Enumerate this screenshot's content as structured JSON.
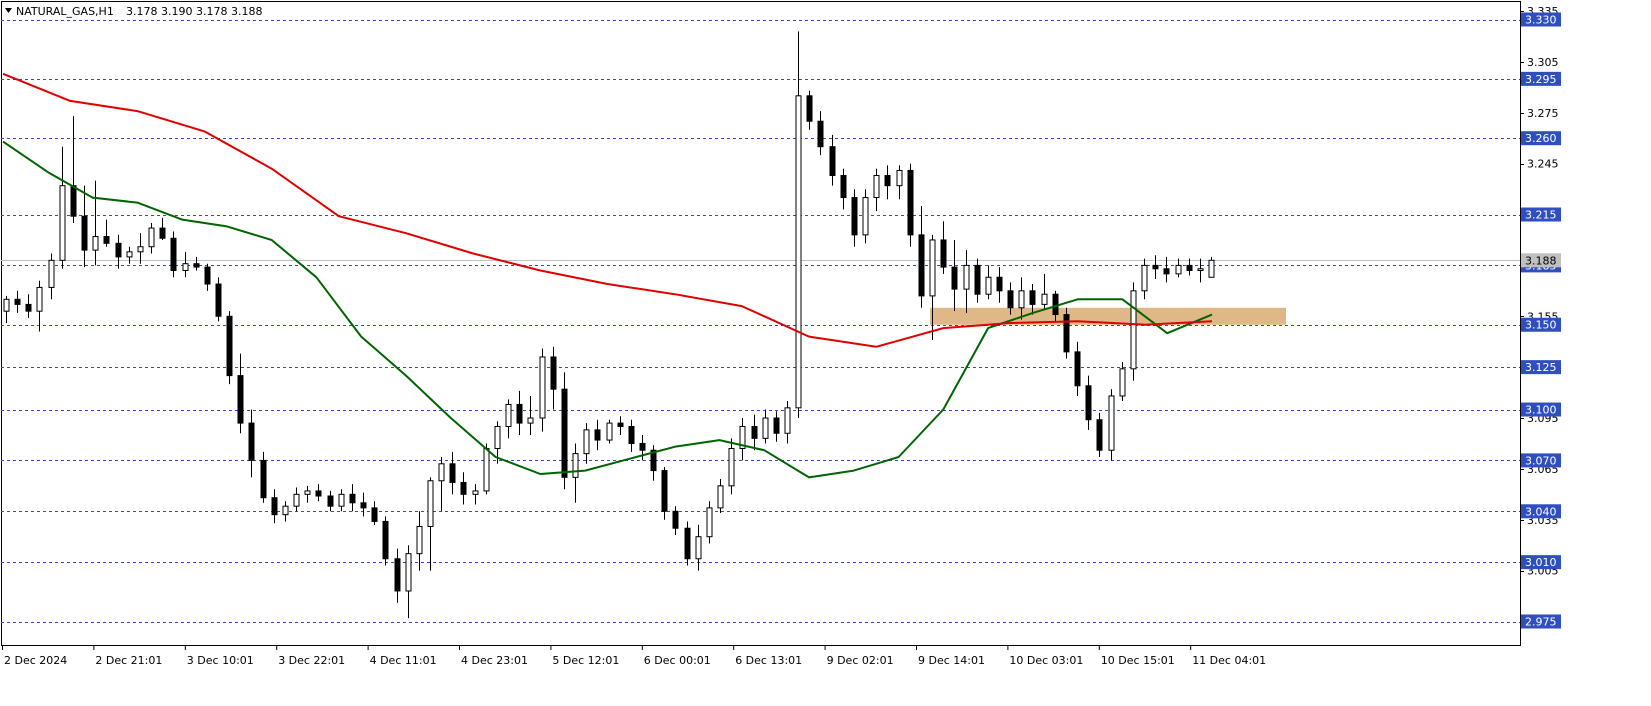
{
  "header": {
    "symbol": "NATURAL_GAS,H1",
    "ohlc": "3.178 3.190 3.178 3.188"
  },
  "chart_data": {
    "type": "candlestick",
    "symbol": "NATURAL_GAS",
    "timeframe": "H1",
    "ylim": [
      2.96,
      3.34
    ],
    "y_ticks": [
      3.335,
      3.305,
      3.275,
      3.245,
      3.215,
      3.185,
      3.155,
      3.125,
      3.095,
      3.065,
      3.035,
      3.005,
      2.975
    ],
    "x_labels": [
      "2 Dec 2024",
      "2 Dec 21:01",
      "3 Dec 10:01",
      "3 Dec 22:01",
      "4 Dec 11:01",
      "4 Dec 23:01",
      "5 Dec 12:01",
      "6 Dec 00:01",
      "6 Dec 13:01",
      "9 Dec 02:01",
      "9 Dec 14:01",
      "10 Dec 03:01",
      "10 Dec 15:01",
      "11 Dec 04:01"
    ],
    "levels": [
      3.33,
      3.295,
      3.26,
      3.215,
      3.185,
      3.15,
      3.125,
      3.1,
      3.07,
      3.04,
      3.01,
      2.975
    ],
    "current_price": 3.188,
    "zone": {
      "from": 3.15,
      "to": 3.16
    },
    "series": [
      {
        "name": "",
        "color": "#006400",
        "values": [
          3.258,
          3.24,
          3.225,
          3.222,
          3.212,
          3.208,
          3.2,
          3.178,
          3.143,
          3.12,
          3.095,
          3.072,
          3.062,
          3.064,
          3.071,
          3.078,
          3.082,
          3.076,
          3.06,
          3.064,
          3.072,
          3.1,
          3.148,
          3.157,
          3.165,
          3.165,
          3.145,
          3.156
        ]
      },
      {
        "name": "",
        "color": "#e00000",
        "values": [
          3.298,
          3.282,
          3.276,
          3.264,
          3.242,
          3.214,
          3.204,
          3.192,
          3.182,
          3.174,
          3.168,
          3.161,
          3.143,
          3.137,
          3.148,
          3.151,
          3.152,
          3.15,
          3.152
        ]
      }
    ],
    "candles": [
      [
        3.158,
        3.167,
        3.151,
        3.165
      ],
      [
        3.165,
        3.17,
        3.157,
        3.162
      ],
      [
        3.162,
        3.168,
        3.154,
        3.158
      ],
      [
        3.158,
        3.176,
        3.146,
        3.172
      ],
      [
        3.172,
        3.192,
        3.165,
        3.188
      ],
      [
        3.188,
        3.255,
        3.183,
        3.232
      ],
      [
        3.232,
        3.273,
        3.21,
        3.214
      ],
      [
        3.214,
        3.232,
        3.184,
        3.194
      ],
      [
        3.194,
        3.235,
        3.185,
        3.202
      ],
      [
        3.202,
        3.212,
        3.196,
        3.198
      ],
      [
        3.198,
        3.203,
        3.183,
        3.19
      ],
      [
        3.19,
        3.196,
        3.186,
        3.193
      ],
      [
        3.193,
        3.204,
        3.186,
        3.196
      ],
      [
        3.196,
        3.21,
        3.192,
        3.207
      ],
      [
        3.207,
        3.213,
        3.2,
        3.201
      ],
      [
        3.201,
        3.205,
        3.178,
        3.182
      ],
      [
        3.182,
        3.193,
        3.178,
        3.186
      ],
      [
        3.186,
        3.19,
        3.182,
        3.184
      ],
      [
        3.184,
        3.186,
        3.17,
        3.174
      ],
      [
        3.174,
        3.178,
        3.152,
        3.155
      ],
      [
        3.155,
        3.158,
        3.115,
        3.12
      ],
      [
        3.12,
        3.133,
        3.086,
        3.092
      ],
      [
        3.092,
        3.1,
        3.06,
        3.07
      ],
      [
        3.07,
        3.075,
        3.045,
        3.048
      ],
      [
        3.048,
        3.053,
        3.033,
        3.038
      ],
      [
        3.038,
        3.046,
        3.034,
        3.043
      ],
      [
        3.043,
        3.054,
        3.04,
        3.05
      ],
      [
        3.05,
        3.055,
        3.045,
        3.052
      ],
      [
        3.052,
        3.056,
        3.046,
        3.049
      ],
      [
        3.049,
        3.052,
        3.04,
        3.043
      ],
      [
        3.043,
        3.053,
        3.04,
        3.05
      ],
      [
        3.05,
        3.056,
        3.04,
        3.045
      ],
      [
        3.045,
        3.051,
        3.037,
        3.042
      ],
      [
        3.042,
        3.046,
        3.032,
        3.034
      ],
      [
        3.034,
        3.037,
        3.008,
        3.012
      ],
      [
        3.012,
        3.018,
        2.986,
        2.993
      ],
      [
        2.993,
        3.02,
        2.977,
        3.015
      ],
      [
        3.015,
        3.04,
        3.005,
        3.031
      ],
      [
        3.031,
        3.06,
        3.005,
        3.058
      ],
      [
        3.058,
        3.072,
        3.04,
        3.068
      ],
      [
        3.068,
        3.075,
        3.05,
        3.057
      ],
      [
        3.057,
        3.063,
        3.044,
        3.05
      ],
      [
        3.05,
        3.056,
        3.044,
        3.052
      ],
      [
        3.052,
        3.08,
        3.05,
        3.077
      ],
      [
        3.077,
        3.093,
        3.068,
        3.09
      ],
      [
        3.09,
        3.106,
        3.083,
        3.103
      ],
      [
        3.103,
        3.111,
        3.085,
        3.092
      ],
      [
        3.092,
        3.108,
        3.085,
        3.095
      ],
      [
        3.095,
        3.136,
        3.087,
        3.131
      ],
      [
        3.131,
        3.137,
        3.1,
        3.112
      ],
      [
        3.112,
        3.122,
        3.053,
        3.06
      ],
      [
        3.06,
        3.08,
        3.045,
        3.074
      ],
      [
        3.074,
        3.092,
        3.068,
        3.088
      ],
      [
        3.088,
        3.094,
        3.076,
        3.082
      ],
      [
        3.082,
        3.094,
        3.08,
        3.092
      ],
      [
        3.092,
        3.096,
        3.085,
        3.09
      ],
      [
        3.09,
        3.094,
        3.075,
        3.08
      ],
      [
        3.08,
        3.085,
        3.07,
        3.076
      ],
      [
        3.076,
        3.079,
        3.058,
        3.064
      ],
      [
        3.064,
        3.066,
        3.035,
        3.04
      ],
      [
        3.04,
        3.043,
        3.026,
        3.03
      ],
      [
        3.03,
        3.034,
        3.008,
        3.012
      ],
      [
        3.012,
        3.032,
        3.005,
        3.025
      ],
      [
        3.025,
        3.046,
        3.021,
        3.042
      ],
      [
        3.042,
        3.059,
        3.039,
        3.055
      ],
      [
        3.055,
        3.083,
        3.05,
        3.077
      ],
      [
        3.077,
        3.095,
        3.07,
        3.09
      ],
      [
        3.09,
        3.097,
        3.076,
        3.083
      ],
      [
        3.083,
        3.1,
        3.08,
        3.095
      ],
      [
        3.095,
        3.099,
        3.081,
        3.086
      ],
      [
        3.086,
        3.105,
        3.08,
        3.101
      ],
      [
        3.101,
        3.323,
        3.095,
        3.285
      ],
      [
        3.285,
        3.288,
        3.265,
        3.27
      ],
      [
        3.27,
        3.276,
        3.25,
        3.255
      ],
      [
        3.255,
        3.262,
        3.232,
        3.238
      ],
      [
        3.238,
        3.242,
        3.218,
        3.225
      ],
      [
        3.225,
        3.23,
        3.196,
        3.203
      ],
      [
        3.203,
        3.23,
        3.198,
        3.225
      ],
      [
        3.225,
        3.242,
        3.217,
        3.238
      ],
      [
        3.238,
        3.244,
        3.224,
        3.232
      ],
      [
        3.232,
        3.244,
        3.224,
        3.241
      ],
      [
        3.241,
        3.245,
        3.196,
        3.203
      ],
      [
        3.203,
        3.22,
        3.16,
        3.167
      ],
      [
        3.167,
        3.203,
        3.141,
        3.2
      ],
      [
        3.2,
        3.211,
        3.18,
        3.184
      ],
      [
        3.184,
        3.2,
        3.158,
        3.171
      ],
      [
        3.171,
        3.194,
        3.157,
        3.185
      ],
      [
        3.185,
        3.189,
        3.163,
        3.168
      ],
      [
        3.168,
        3.185,
        3.165,
        3.178
      ],
      [
        3.178,
        3.184,
        3.163,
        3.17
      ],
      [
        3.17,
        3.175,
        3.156,
        3.16
      ],
      [
        3.16,
        3.178,
        3.153,
        3.17
      ],
      [
        3.17,
        3.174,
        3.156,
        3.162
      ],
      [
        3.162,
        3.18,
        3.159,
        3.168
      ],
      [
        3.168,
        3.17,
        3.152,
        3.156
      ],
      [
        3.156,
        3.16,
        3.13,
        3.134
      ],
      [
        3.134,
        3.14,
        3.108,
        3.114
      ],
      [
        3.114,
        3.12,
        3.088,
        3.094
      ],
      [
        3.094,
        3.098,
        3.072,
        3.076
      ],
      [
        3.076,
        3.112,
        3.07,
        3.108
      ],
      [
        3.108,
        3.128,
        3.105,
        3.124
      ],
      [
        3.124,
        3.175,
        3.117,
        3.17
      ],
      [
        3.17,
        3.189,
        3.165,
        3.185
      ],
      [
        3.185,
        3.191,
        3.177,
        3.183
      ],
      [
        3.183,
        3.19,
        3.175,
        3.18
      ],
      [
        3.18,
        3.189,
        3.178,
        3.185
      ],
      [
        3.185,
        3.189,
        3.179,
        3.182
      ],
      [
        3.182,
        3.189,
        3.175,
        3.183
      ],
      [
        3.178,
        3.19,
        3.178,
        3.188
      ]
    ]
  }
}
